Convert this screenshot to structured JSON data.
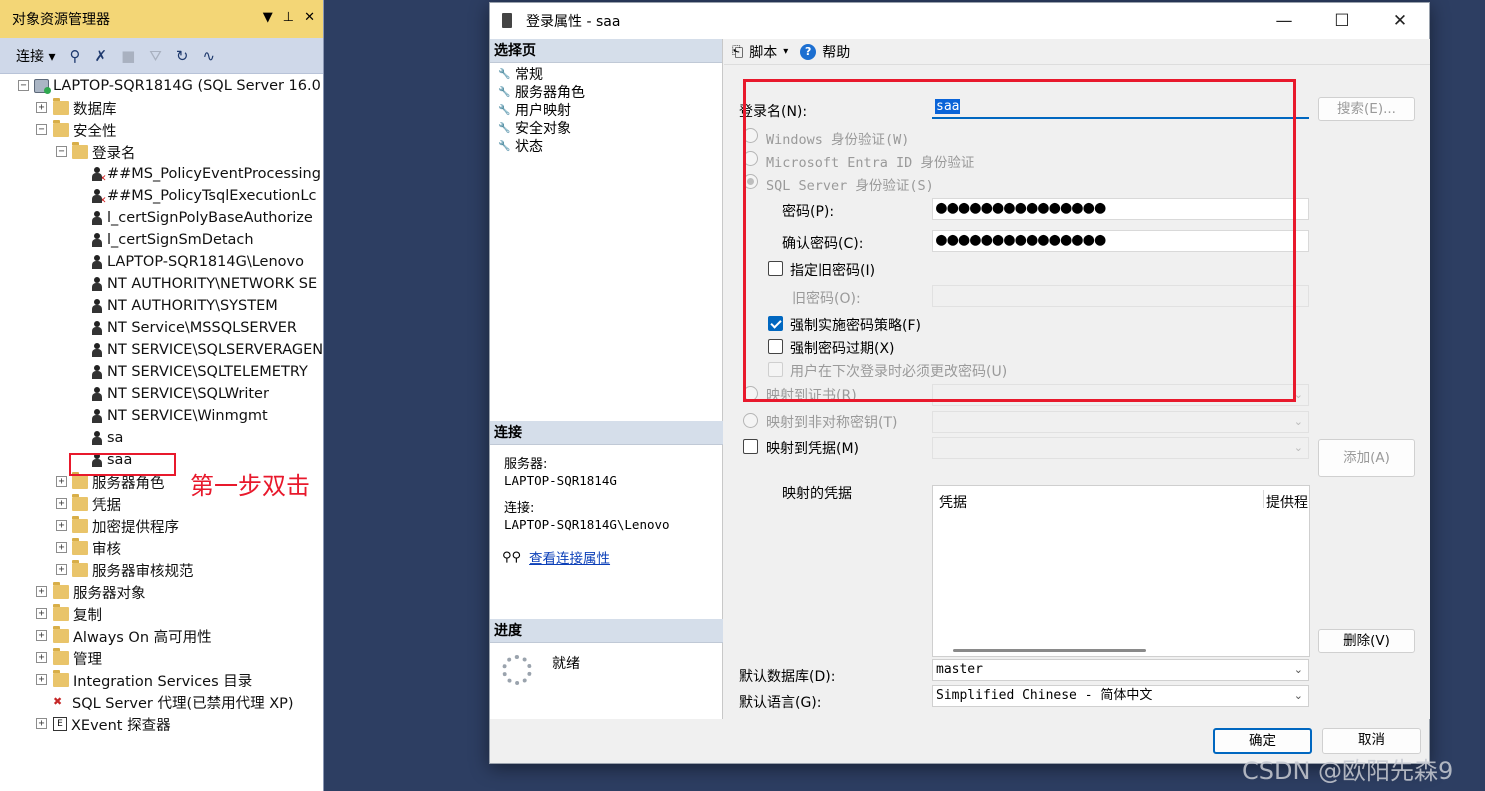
{
  "object_explorer": {
    "title": "对象资源管理器",
    "title_buttons": [
      "▼",
      "📌",
      "✕"
    ],
    "toolbar": {
      "connect_label": "连接"
    },
    "tree": [
      {
        "label": "LAPTOP-SQR1814G (SQL Server 16.0",
        "level": 0,
        "icon": "server-icon",
        "toggle": "−"
      },
      {
        "label": "数据库",
        "level": 1,
        "icon": "folder-icon",
        "toggle": "+"
      },
      {
        "label": "安全性",
        "level": 1,
        "icon": "folder-icon",
        "toggle": "−"
      },
      {
        "label": "登录名",
        "level": 2,
        "icon": "folder-icon",
        "toggle": "−"
      },
      {
        "label": "##MS_PolicyEventProcessing",
        "level": 3,
        "icon": "disabled-user-icon"
      },
      {
        "label": "##MS_PolicyTsqlExecutionLc",
        "level": 3,
        "icon": "disabled-user-icon"
      },
      {
        "label": "l_certSignPolyBaseAuthorize",
        "level": 3,
        "icon": "user-icon"
      },
      {
        "label": "l_certSignSmDetach",
        "level": 3,
        "icon": "user-icon"
      },
      {
        "label": "LAPTOP-SQR1814G\\Lenovo",
        "level": 3,
        "icon": "user-icon"
      },
      {
        "label": "NT AUTHORITY\\NETWORK SE",
        "level": 3,
        "icon": "user-icon"
      },
      {
        "label": "NT AUTHORITY\\SYSTEM",
        "level": 3,
        "icon": "user-icon"
      },
      {
        "label": "NT Service\\MSSQLSERVER",
        "level": 3,
        "icon": "user-icon"
      },
      {
        "label": "NT SERVICE\\SQLSERVERAGEN",
        "level": 3,
        "icon": "user-icon"
      },
      {
        "label": "NT SERVICE\\SQLTELEMETRY",
        "level": 3,
        "icon": "user-icon"
      },
      {
        "label": "NT SERVICE\\SQLWriter",
        "level": 3,
        "icon": "user-icon"
      },
      {
        "label": "NT SERVICE\\Winmgmt",
        "level": 3,
        "icon": "user-icon"
      },
      {
        "label": "sa",
        "level": 3,
        "icon": "user-icon"
      },
      {
        "label": "saa",
        "level": 3,
        "icon": "user-icon"
      },
      {
        "label": "服务器角色",
        "level": 2,
        "icon": "folder-icon",
        "toggle": "+"
      },
      {
        "label": "凭据",
        "level": 2,
        "icon": "folder-icon",
        "toggle": "+"
      },
      {
        "label": "加密提供程序",
        "level": 2,
        "icon": "folder-icon",
        "toggle": "+"
      },
      {
        "label": "审核",
        "level": 2,
        "icon": "folder-icon",
        "toggle": "+"
      },
      {
        "label": "服务器审核规范",
        "level": 2,
        "icon": "folder-icon",
        "toggle": "+"
      },
      {
        "label": "服务器对象",
        "level": 1,
        "icon": "folder-icon",
        "toggle": "+"
      },
      {
        "label": "复制",
        "level": 1,
        "icon": "folder-icon",
        "toggle": "+"
      },
      {
        "label": "Always On 高可用性",
        "level": 1,
        "icon": "folder-icon",
        "toggle": "+"
      },
      {
        "label": "管理",
        "level": 1,
        "icon": "folder-icon",
        "toggle": "+"
      },
      {
        "label": "Integration Services 目录",
        "level": 1,
        "icon": "folder-icon",
        "toggle": "+"
      },
      {
        "label": "SQL Server 代理(已禁用代理 XP)",
        "level": 1,
        "icon": "agent-icon"
      },
      {
        "label": "XEvent 探查器",
        "level": 1,
        "icon": "xevent-icon",
        "toggle": "+"
      }
    ]
  },
  "annotation": {
    "step_label": "第一步双击",
    "color": "#e8192c"
  },
  "dialog": {
    "title": "登录属性 - saa",
    "controls": {
      "minimize": "—",
      "maximize": "☐",
      "close": "✕"
    },
    "select_page": {
      "header": "选择页",
      "items": [
        "常规",
        "服务器角色",
        "用户映射",
        "安全对象",
        "状态"
      ]
    },
    "connection": {
      "header": "连接",
      "server_label": "服务器:",
      "server_value": "LAPTOP-SQR1814G",
      "connection_label": "连接:",
      "connection_value": "LAPTOP-SQR1814G\\Lenovo",
      "view_link": "查看连接属性"
    },
    "progress": {
      "header": "进度",
      "status": "就绪"
    },
    "toolbar": {
      "script_label": "脚本",
      "help_label": "帮助"
    },
    "general": {
      "login_name_label": "登录名(N):",
      "login_name_value": "saa",
      "search_button": "搜索(E)...",
      "auth_windows": "Windows 身份验证(W)",
      "auth_entra": "Microsoft Entra ID 身份验证",
      "auth_sql": "SQL Server 身份验证(S)",
      "password_label": "密码(P):",
      "password_value": "●●●●●●●●●●●●●●●",
      "confirm_label": "确认密码(C):",
      "confirm_value": "●●●●●●●●●●●●●●●",
      "specify_old_label": "指定旧密码(I)",
      "old_password_label": "旧密码(O):",
      "enforce_policy_label": "强制实施密码策略(F)",
      "enforce_policy_checked": true,
      "enforce_expiration_label": "强制密码过期(X)",
      "enforce_expiration_checked": false,
      "must_change_label": "用户在下次登录时必须更改密码(U)",
      "map_cert_label": "映射到证书(R)",
      "map_asym_label": "映射到非对称密钥(T)",
      "map_cred_label": "映射到凭据(M)",
      "add_button": "添加(A)",
      "mapped_creds_label": "映射的凭据",
      "grid_col_credential": "凭据",
      "grid_col_provider": "提供程",
      "remove_button": "删除(V)",
      "default_db_label": "默认数据库(D):",
      "default_db_value": "master",
      "default_lang_label": "默认语言(G):",
      "default_lang_value": "Simplified Chinese - 简体中文"
    },
    "buttons": {
      "ok": "确定",
      "cancel": "取消"
    }
  },
  "watermark": "CSDN @欧阳先森9"
}
